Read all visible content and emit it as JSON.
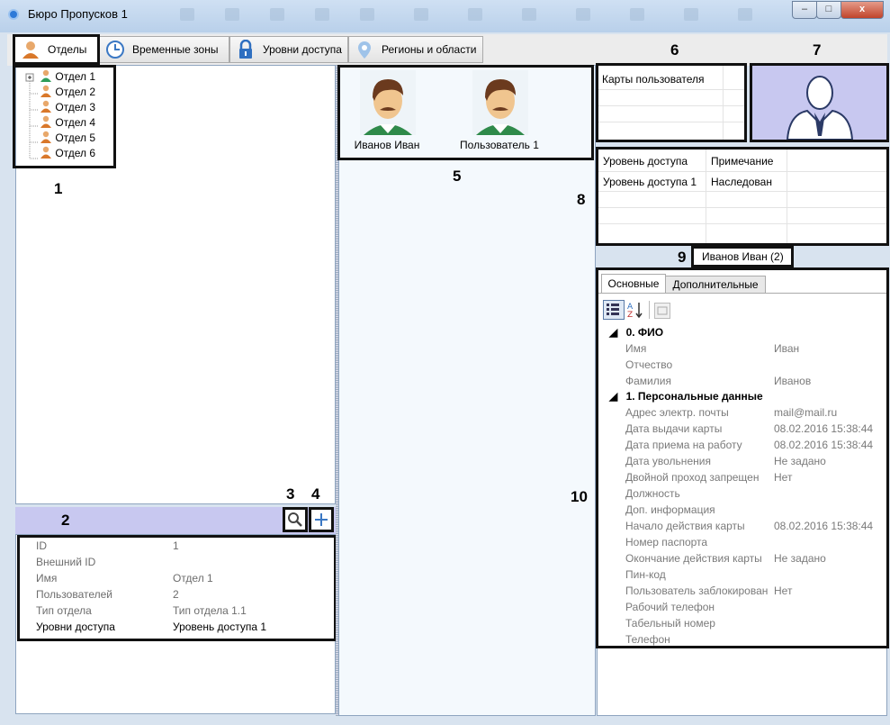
{
  "window": {
    "title": "Бюро Пропусков 1",
    "minimize": "–",
    "maximize": "□",
    "close": "x"
  },
  "tabs": [
    {
      "label": "Отделы"
    },
    {
      "label": "Временные зоны"
    },
    {
      "label": "Уровни доступа"
    },
    {
      "label": "Регионы и области"
    }
  ],
  "callouts": {
    "n1": "1",
    "n2": "2",
    "n3": "3",
    "n4": "4",
    "n5": "5",
    "n6": "6",
    "n7": "7",
    "n8": "8",
    "n9": "9",
    "n10": "10"
  },
  "departments": [
    "Отдел 1",
    "Отдел 2",
    "Отдел 3",
    "Отдел 4",
    "Отдел 5",
    "Отдел 6"
  ],
  "department_props": [
    {
      "key": "ID",
      "value": "1"
    },
    {
      "key": "Внешний ID",
      "value": ""
    },
    {
      "key": "Имя",
      "value": "Отдел 1"
    },
    {
      "key": "Пользователей",
      "value": "2"
    },
    {
      "key": "Тип отдела",
      "value": "Тип отдела 1.1"
    },
    {
      "key": "Уровни доступа",
      "value": "Уровень доступа 1"
    }
  ],
  "users": [
    {
      "name": "Иванов Иван"
    },
    {
      "name": "Пользователь 1"
    }
  ],
  "cards": {
    "header": "Карты пользователя"
  },
  "access_table": {
    "headers": [
      "Уровень доступа",
      "Примечание"
    ],
    "rows": [
      [
        "Уровень доступа 1",
        "Наследован"
      ]
    ]
  },
  "selected_user": "Иванов Иван (2)",
  "detail_tabs": [
    "Основные",
    "Дополнительные"
  ],
  "property_grid": {
    "sections": [
      {
        "title": "0. ФИО",
        "rows": [
          {
            "key": "Имя",
            "value": "Иван"
          },
          {
            "key": "Отчество",
            "value": ""
          },
          {
            "key": "Фамилия",
            "value": "Иванов"
          }
        ]
      },
      {
        "title": "1. Персональные данные",
        "rows": [
          {
            "key": "Адрес электр. почты",
            "value": "mail@mail.ru"
          },
          {
            "key": "Дата выдачи карты",
            "value": "08.02.2016 15:38:44"
          },
          {
            "key": "Дата приема на работу",
            "value": "08.02.2016 15:38:44"
          },
          {
            "key": "Дата увольнения",
            "value": "Не задано"
          },
          {
            "key": "Двойной проход запрещен",
            "value": "Нет"
          },
          {
            "key": "Должность",
            "value": ""
          },
          {
            "key": "Доп. информация",
            "value": ""
          },
          {
            "key": "Начало действия карты",
            "value": "08.02.2016 15:38:44"
          },
          {
            "key": "Номер паспорта",
            "value": ""
          },
          {
            "key": "Окончание действия карты",
            "value": "Не задано"
          },
          {
            "key": "Пин-код",
            "value": ""
          },
          {
            "key": "Пользователь заблокирован",
            "value": "Нет"
          },
          {
            "key": "Рабочий телефон",
            "value": ""
          },
          {
            "key": "Табельный номер",
            "value": ""
          },
          {
            "key": "Телефон",
            "value": ""
          }
        ]
      }
    ]
  },
  "colors": {
    "accent_band": "#c8c8f0",
    "photo_bg": "#c8c8f0",
    "highlight": "#111111"
  },
  "icons": [
    "app-logo-icon",
    "department-icon",
    "clock-icon",
    "lock-icon",
    "map-pin-icon",
    "search-icon",
    "plus-icon",
    "sort-categorized-icon",
    "sort-alpha-icon",
    "property-pages-icon"
  ]
}
